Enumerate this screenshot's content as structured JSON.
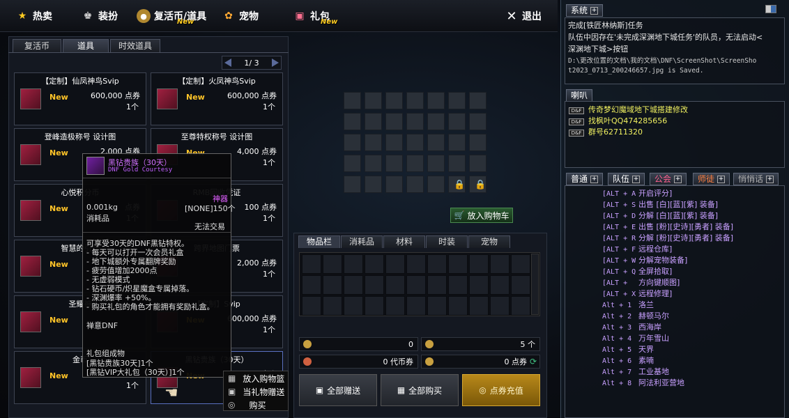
{
  "menu": {
    "hot": "热卖",
    "outfit": "装扮",
    "revive": "复活币/道具",
    "revive_new": "New",
    "pet": "宠物",
    "gift": "礼包",
    "gift_new": "New",
    "exit": "退出"
  },
  "left": {
    "tabs": [
      "复活币",
      "道具",
      "时效道具"
    ],
    "page": "1/ 3",
    "items": [
      {
        "name": "【定制】仙凤神鸟Svip",
        "new": "New",
        "price": "600,000 点券",
        "qty": "1个"
      },
      {
        "name": "【定制】火凤神鸟Svip",
        "new": "New",
        "price": "600,000 点券",
        "qty": "1个"
      },
      {
        "name": "登峰造极称号  设计图",
        "new": "New",
        "price": "2,000 点券",
        "qty": "1个"
      },
      {
        "name": "至尊特权称号  设计图",
        "new": "New",
        "price": "4,000 点券",
        "qty": "1个"
      },
      {
        "name": "心悦积分币",
        "new": "New",
        "price": "点券",
        "qty": "1个"
      },
      {
        "name": "RMB回收凭证",
        "new": "",
        "price": "100 点券",
        "qty": "1个"
      },
      {
        "name": "智慧的引导",
        "new": "New",
        "price": "",
        "qty": ""
      },
      {
        "name": "跨界地图门票",
        "new": "",
        "price": "2,000 点券",
        "qty": "1个"
      },
      {
        "name": "圣耀神",
        "new": "New",
        "price": "",
        "qty": ""
      },
      {
        "name": "【定制】Svip",
        "new": "New",
        "price": "600,000 点券",
        "qty": "1个"
      },
      {
        "name": "金币",
        "new": "New",
        "price": "",
        "qty": "1个"
      },
      {
        "name": "黑钻贵族（30天）",
        "new": "New",
        "price": "点券",
        "qty": ""
      }
    ]
  },
  "tooltip": {
    "title": "黑钻贵族（30天）",
    "subtitle": "DNF Gold Courtesy",
    "weight": "0.001kg",
    "type": "消耗品",
    "rarity": "神器",
    "trade": "[NONE]150个",
    "no_trade": "无法交易",
    "desc": [
      "可享受30天的DNF黑钻特权。",
      "- 每天可以打开一次会员礼盒",
      "- 地下城额外专属翻牌奖励",
      "- 疲劳值增加2000点",
      "- 无虚弱模式",
      "- 钻石硬币/炽星魔盒专属掉落。",
      "- 深渊爆率 +50%。",
      "- 购买礼包的角色才能拥有奖励礼盒。"
    ],
    "footer_label": "禅意DNF",
    "contents_title": "礼包组成物",
    "contents": [
      "[黑钻贵族30天]1个",
      "[黑钻VIP大礼包（30天）]1个"
    ]
  },
  "context_menu": [
    "放入购物篮",
    "当礼物赠送",
    "购买"
  ],
  "center": {
    "add_to_cart": "放入购物车"
  },
  "inventory": {
    "tabs": [
      "物品栏",
      "消耗品",
      "材料",
      "时装",
      "宠物"
    ],
    "stat1": "0",
    "stat2": "5 个",
    "stat3": "0 代币券",
    "stat4": "0 点券",
    "btn_gift_all": "全部赠送",
    "btn_buy_all": "全部购买",
    "btn_recharge": "点券充值"
  },
  "chat": {
    "system_tab": "系统",
    "system_lines": [
      "完成[铁匠林纳斯]任务",
      "队伍中因存在'未完成深渊地下城任务'的队员，无法启动<",
      "深渊地下城>按钮",
      "D:\\更改位置的文档\\我的文档\\DNF\\ScreenShot\\ScreenSho",
      "t2023_0713_200246657.jpg is Saved."
    ],
    "horn_tab": "喇叭",
    "horn_lines": [
      "传奇梦幻魔域地下城搭建修改",
      "找枫叶QQ474285656",
      "群号62711320"
    ],
    "tabs": [
      "普通",
      "队伍",
      "公会",
      "师徒",
      "悄悄话"
    ],
    "shortcuts": [
      {
        "key": "[ALT + A",
        "text": "开启评分]"
      },
      {
        "key": "[ALT + S",
        "text": "出售 [白][蓝][紫] 装备]"
      },
      {
        "key": "[ALT + D",
        "text": "分解 [白][蓝][紫] 装备]"
      },
      {
        "key": "[ALT + E",
        "text": "出售 [粉][史诗][勇者] 装备]"
      },
      {
        "key": "[ALT + R",
        "text": "分解 [粉][史诗][勇者] 装备]"
      },
      {
        "key": "[ALT + F",
        "text": "远程仓库]"
      },
      {
        "key": "[ALT + W",
        "text": "分解宠物装备]"
      },
      {
        "key": "[ALT + Q",
        "text": "全屏拾取]"
      },
      {
        "key": "[ALT +",
        "text": "方向键顺图]"
      },
      {
        "key": "[ALT + X",
        "text": "远程修理]"
      },
      {
        "key": "Alt + 1",
        "text": "洛兰"
      },
      {
        "key": "Alt + 2",
        "text": "赫顿马尔"
      },
      {
        "key": "Alt + 3",
        "text": "西海岸"
      },
      {
        "key": "Alt + 4",
        "text": "万年雪山"
      },
      {
        "key": "Alt + 5",
        "text": "天界"
      },
      {
        "key": "Alt + 6",
        "text": "素喃"
      },
      {
        "key": "Alt + 7",
        "text": "工业基地"
      },
      {
        "key": "Alt + 8",
        "text": "阿法利亚营地"
      }
    ]
  },
  "colors": {
    "gold": "#ffc428",
    "system_text": "#e8e8e8",
    "horn_text": "#f0f060",
    "shortcut_text": "#c8a0ff",
    "tooltip_title": "#d070ff"
  }
}
